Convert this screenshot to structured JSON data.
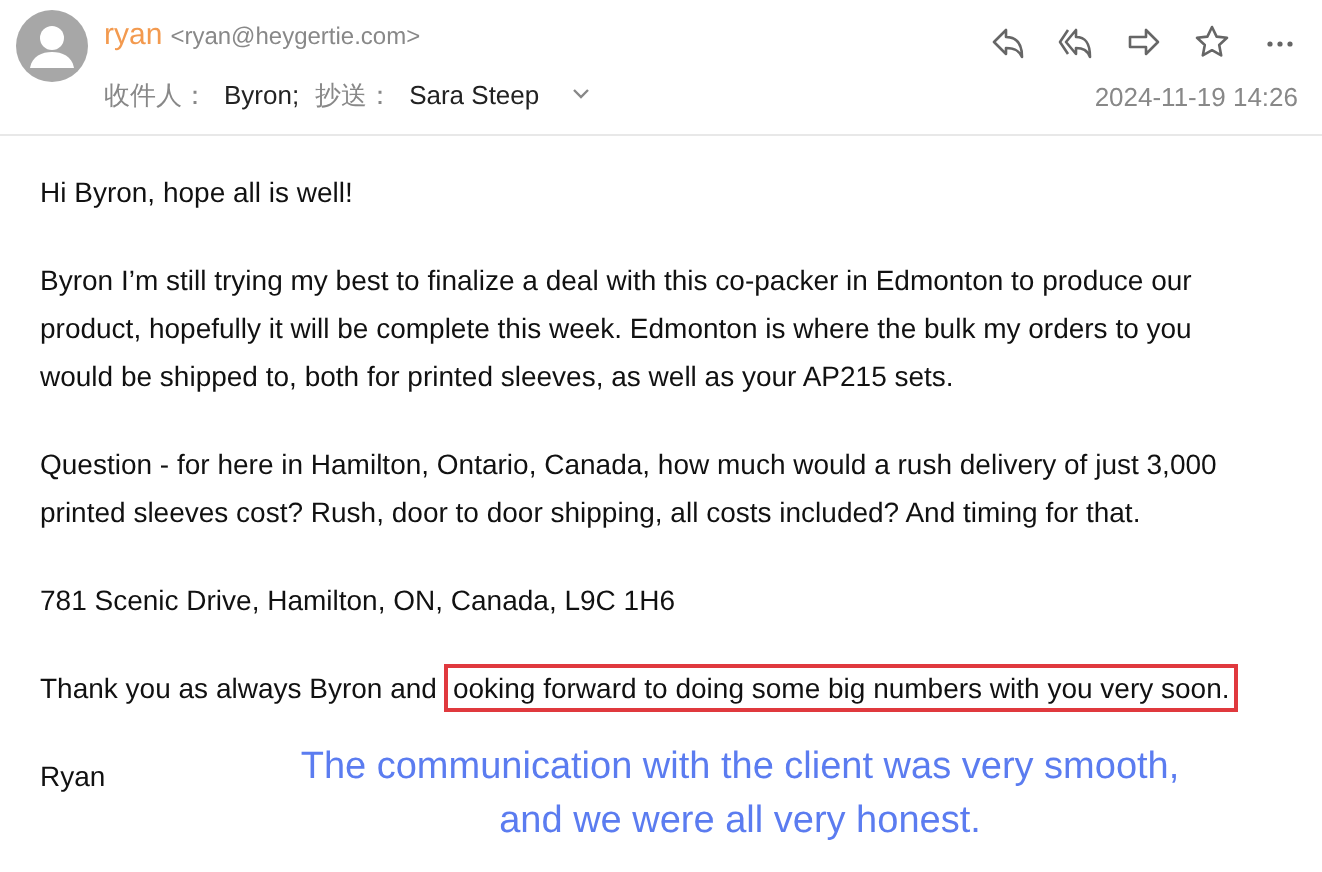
{
  "header": {
    "sender_name": "ryan",
    "sender_email": "<ryan@heygertie.com>",
    "to_label": "收件人：",
    "to": "Byron;",
    "cc_label": "抄送：",
    "cc": "Sara Steep",
    "date": "2024-11-19 14:26"
  },
  "body": {
    "paragraphs": [
      "Hi Byron, hope all is well!",
      "Byron I’m still trying my best to finalize a deal with this co-packer in Edmonton to produce our product, hopefully it will be complete this week. Edmonton is where the bulk my orders to you would be shipped to, both for printed sleeves, as well as your AP215 sets.",
      "Question - for here in Hamilton, Ontario, Canada, how much would a rush delivery of just 3,000 printed sleeves cost? Rush, door to door shipping, all costs included? And timing for that.",
      "781 Scenic Drive, Hamilton, ON, Canada, L9C 1H6"
    ],
    "closing": {
      "text": "Thank you as always Byron and",
      "highlighted": "ooking forward to doing some big numbers with you very soon."
    },
    "signature": "Ryan"
  },
  "annotation": {
    "lines": [
      "The communication with the client was very smooth,",
      "and we were all very honest."
    ]
  }
}
